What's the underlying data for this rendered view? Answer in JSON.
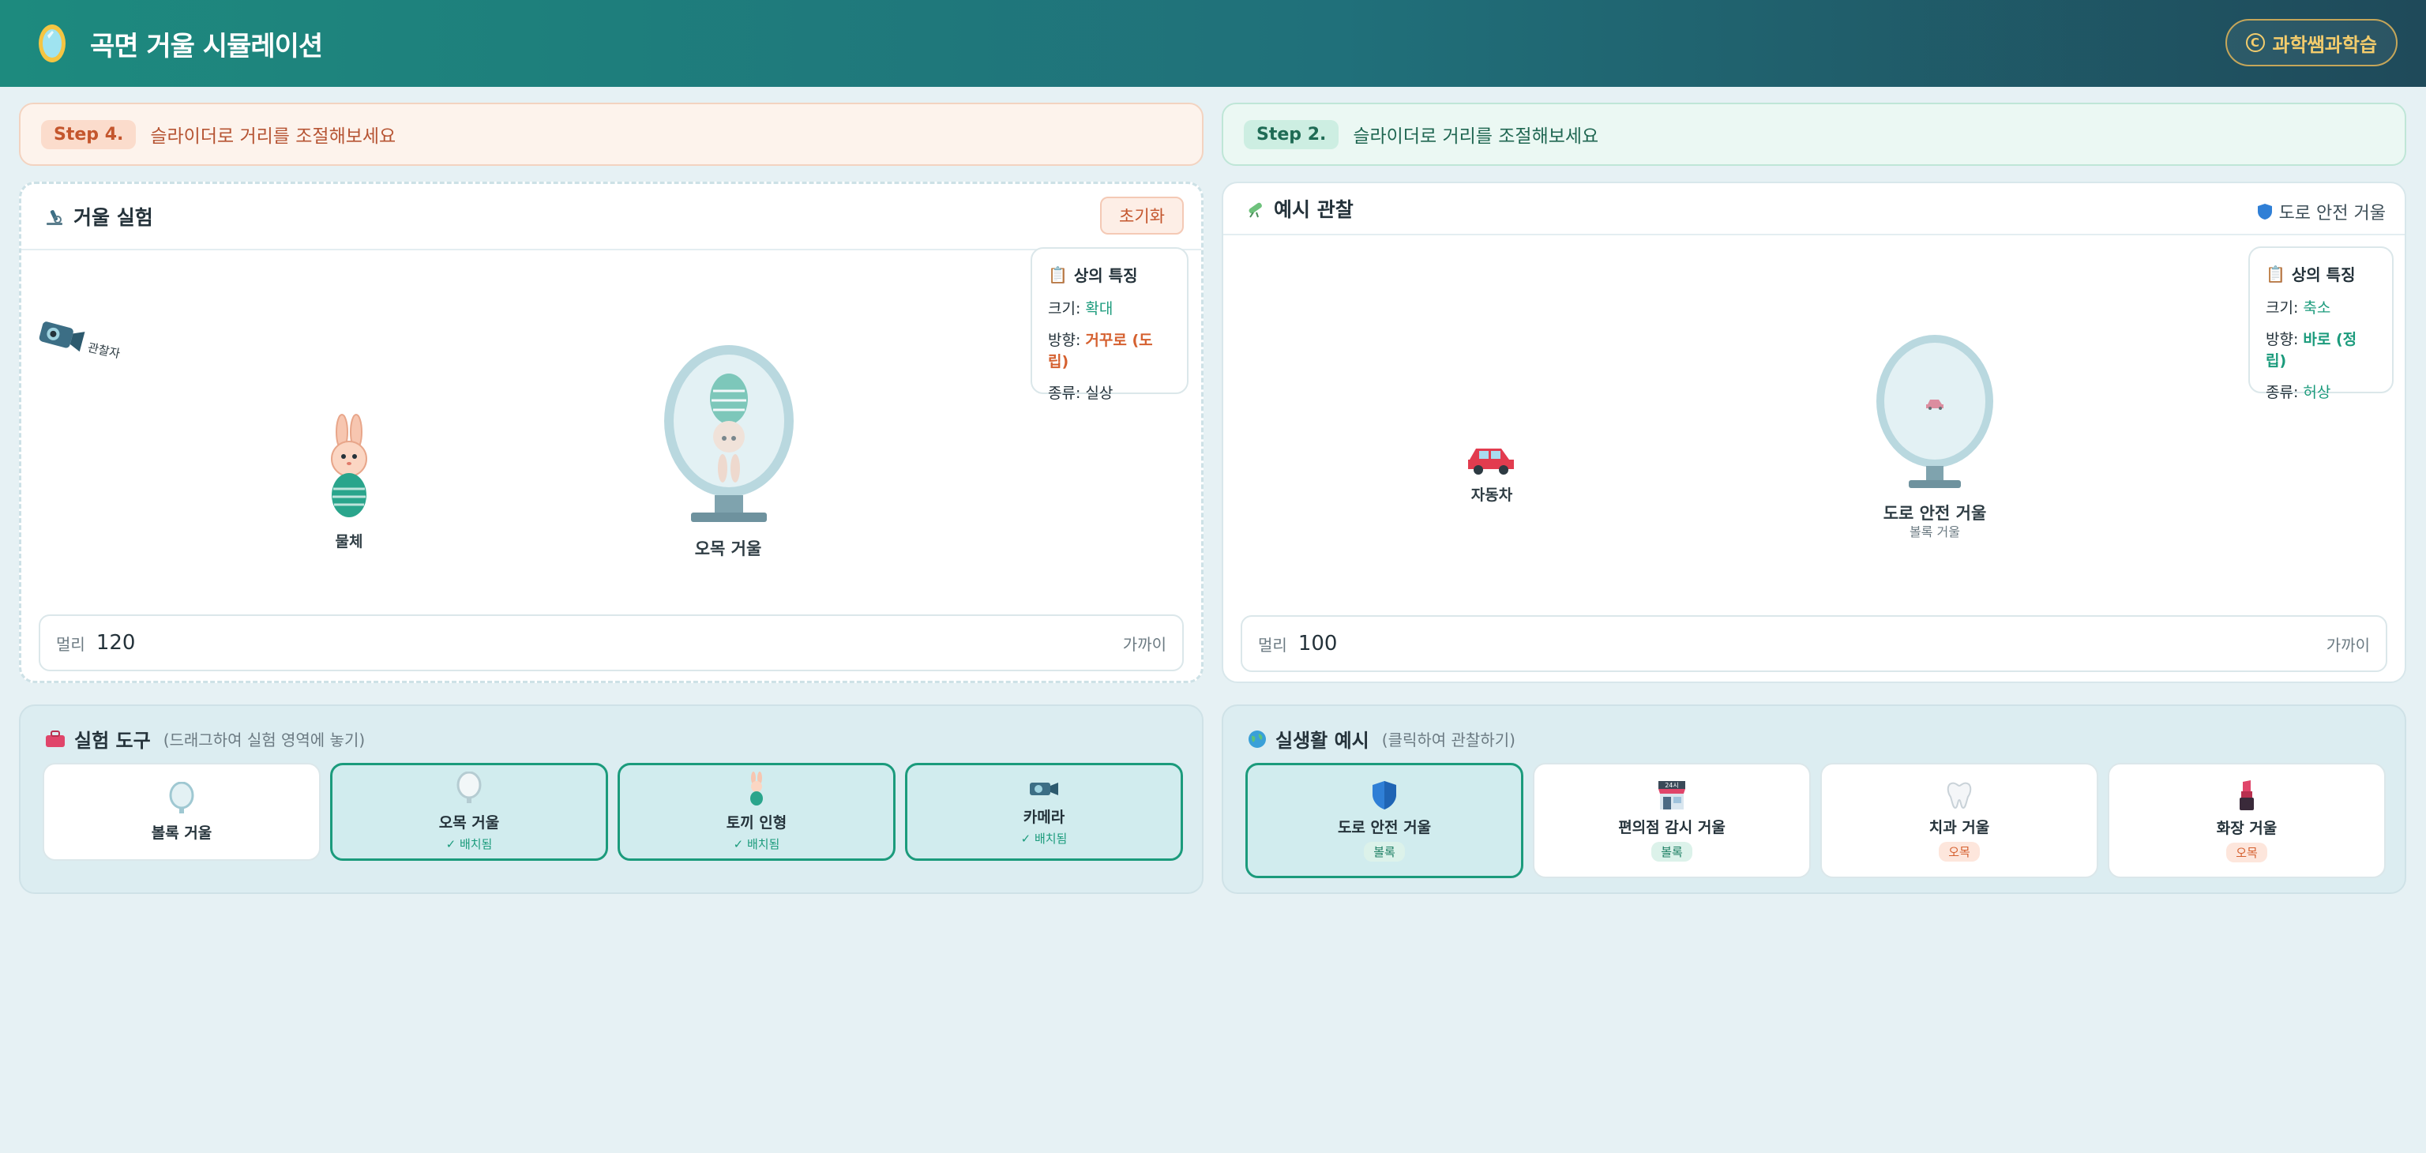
{
  "header": {
    "title": "곡면 거울 시뮬레이션",
    "brand": "과학쌤과학습",
    "brand_mark": "C"
  },
  "left": {
    "step_badge": "Step 4.",
    "step_text": "슬라이더로 거리를 조절해보세요",
    "panel_title": "거울 실험",
    "reset_label": "초기화",
    "observer_label": "관찰자",
    "object_label": "물체",
    "mirror_label": "오목 거울",
    "info": {
      "title": "상의 특징",
      "size_label": "크기:",
      "size_value": "확대",
      "dir_label": "방향:",
      "dir_value": "거꾸로 (도립)",
      "type_label": "종류:",
      "type_value": "실상"
    },
    "distance": {
      "label": "멀리",
      "value": "120",
      "hint": "가까이"
    }
  },
  "right": {
    "step_badge": "Step 2.",
    "step_text": "슬라이더로 거리를 조절해보세요",
    "panel_title": "예시 관찰",
    "tag": "도로 안전 거울",
    "car_label": "자동차",
    "mirror_label": "도로 안전 거울",
    "mirror_sub": "볼록 거울",
    "info": {
      "title": "상의 특징",
      "size_label": "크기:",
      "size_value": "축소",
      "dir_label": "방향:",
      "dir_value": "바로 (정립)",
      "type_label": "종류:",
      "type_value": "허상"
    },
    "distance": {
      "label": "멀리",
      "value": "100",
      "hint": "가까이"
    }
  },
  "tools": {
    "title": "실험 도구",
    "hint": "(드래그하여 실험 영역에 놓기)",
    "items": [
      {
        "label": "볼록 거울",
        "status": "",
        "icon": "convex-mirror-icon"
      },
      {
        "label": "오목 거울",
        "status": "✓ 배치됨",
        "icon": "concave-mirror-icon"
      },
      {
        "label": "토끼 인형",
        "status": "✓ 배치됨",
        "icon": "rabbit-doll-icon"
      },
      {
        "label": "카메라",
        "status": "✓ 배치됨",
        "icon": "camera-icon"
      }
    ]
  },
  "examples": {
    "title": "실생활 예시",
    "hint": "(클릭하여 관찰하기)",
    "items": [
      {
        "label": "도로 안전 거울",
        "badge": "볼록",
        "icon": "shield-icon"
      },
      {
        "label": "편의점 감시 거울",
        "badge": "볼록",
        "icon": "store-icon",
        "store_sign": "24시"
      },
      {
        "label": "치과 거울",
        "badge": "오목",
        "icon": "tooth-icon"
      },
      {
        "label": "화장 거울",
        "badge": "오목",
        "icon": "lipstick-icon"
      }
    ]
  },
  "colors": {
    "accent": "#1b9b7c",
    "warning": "#d5602f",
    "header_start": "#1d8a7e",
    "header_end": "#1f4a5a"
  }
}
